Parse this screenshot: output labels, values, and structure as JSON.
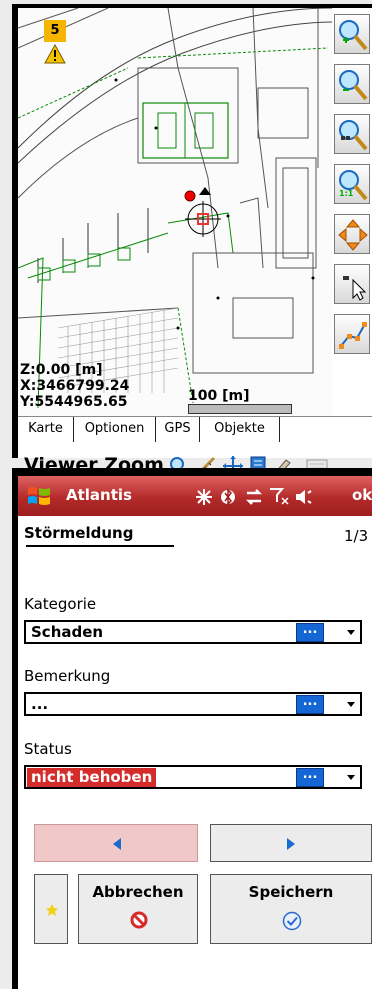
{
  "map": {
    "warning_count": "5",
    "z_readout": "Z:0.00 [m]",
    "x_readout": "X:3466799.24",
    "y_readout": "Y:5544965.65",
    "scale_label": "100 [m]"
  },
  "toolbar": {
    "icons": [
      "zoom-in-icon",
      "zoom-out-icon",
      "zoom-extent-icon",
      "zoom-1-1-icon",
      "pan-arrows-icon",
      "select-cursor-icon",
      "polyline-edit-icon"
    ]
  },
  "tabs": [
    "Karte",
    "Optionen",
    "GPS",
    "Objekte"
  ],
  "zoom_toolbar": {
    "title": "Viewer Zoom"
  },
  "titlebar": {
    "app_name": "Atlantis",
    "ok_label": "ok"
  },
  "form": {
    "title": "Störmeldung",
    "page": "1/3",
    "kategorie_label": "Kategorie",
    "kategorie_value": "Schaden",
    "bemerkung_label": "Bemerkung",
    "bemerkung_value": "...",
    "status_label": "Status",
    "status_value": "nicht behoben",
    "dots_label": "...",
    "cancel_label": "Abbrechen",
    "save_label": "Speichern"
  },
  "colors": {
    "status_highlight": "#d42b2b",
    "title_bar": "#b42a2a",
    "dots_button": "#1467d4",
    "prev_button_bg": "#f0c8c8"
  }
}
